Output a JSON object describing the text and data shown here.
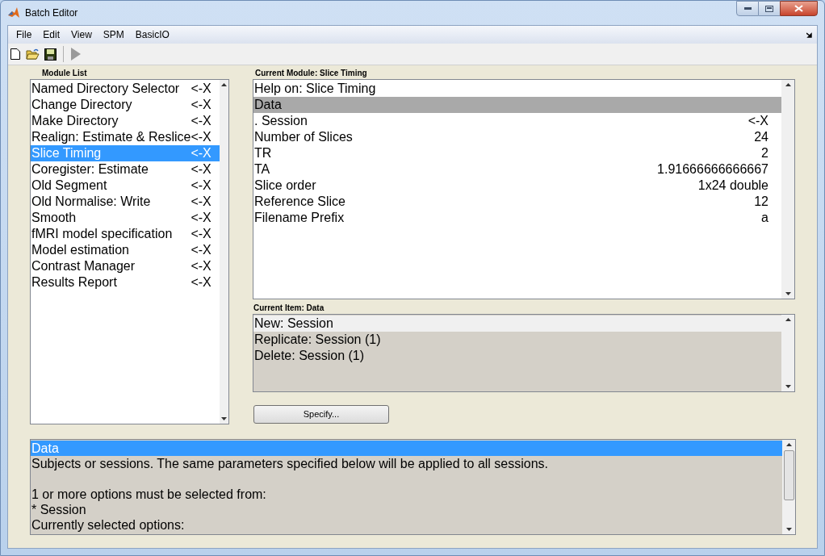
{
  "window": {
    "title": "Batch Editor"
  },
  "menu": [
    "File",
    "Edit",
    "View",
    "SPM",
    "BasicIO"
  ],
  "module_list": {
    "label": "Module List",
    "items": [
      {
        "name": "Named Directory Selector",
        "action": "<-X",
        "selected": false
      },
      {
        "name": "Change Directory",
        "action": "<-X",
        "selected": false
      },
      {
        "name": "Make Directory",
        "action": "<-X",
        "selected": false
      },
      {
        "name": "Realign: Estimate & Reslice",
        "action": "<-X",
        "selected": false
      },
      {
        "name": "Slice Timing",
        "action": "<-X",
        "selected": true
      },
      {
        "name": "Coregister: Estimate",
        "action": "<-X",
        "selected": false
      },
      {
        "name": "Old Segment",
        "action": "<-X",
        "selected": false
      },
      {
        "name": "Old Normalise: Write",
        "action": "<-X",
        "selected": false
      },
      {
        "name": "Smooth",
        "action": "<-X",
        "selected": false
      },
      {
        "name": "fMRI model specification",
        "action": "<-X",
        "selected": false
      },
      {
        "name": "Model estimation",
        "action": "<-X",
        "selected": false
      },
      {
        "name": "Contrast Manager",
        "action": "<-X",
        "selected": false
      },
      {
        "name": "Results Report",
        "action": "<-X",
        "selected": false
      }
    ]
  },
  "current_module": {
    "label": "Current Module: Slice Timing",
    "items": [
      {
        "name": "Help on: Slice Timing",
        "selected": false
      },
      {
        "name": "Data",
        "selected": true
      },
      {
        "name": ". Session",
        "value": "<-X",
        "selected": false
      },
      {
        "name": "Number of Slices",
        "value": "24",
        "selected": false
      },
      {
        "name": "TR",
        "value": "2",
        "selected": false
      },
      {
        "name": "TA",
        "value": "1.91666666666667",
        "selected": false
      },
      {
        "name": "Slice order",
        "value": "1x24 double",
        "selected": false
      },
      {
        "name": "Reference Slice",
        "value": "12",
        "selected": false
      },
      {
        "name": "Filename Prefix",
        "value": "a",
        "selected": false
      }
    ]
  },
  "current_item": {
    "label": "Current Item: Data",
    "items": [
      {
        "label": "New: Session",
        "selected": true
      },
      {
        "label": "Replicate: Session (1)",
        "selected": false
      },
      {
        "label": "Delete: Session (1)",
        "selected": false
      }
    ]
  },
  "specify_button": "Specify...",
  "help": {
    "heading": {
      "text": "Data",
      "selected": true
    },
    "paragraphs": [
      [
        "Subjects or sessions. The same parameters specified below will be applied to all sessions."
      ],
      [
        "1 or more options must be selected from:",
        "* Session",
        "Currently selected options:"
      ]
    ]
  }
}
